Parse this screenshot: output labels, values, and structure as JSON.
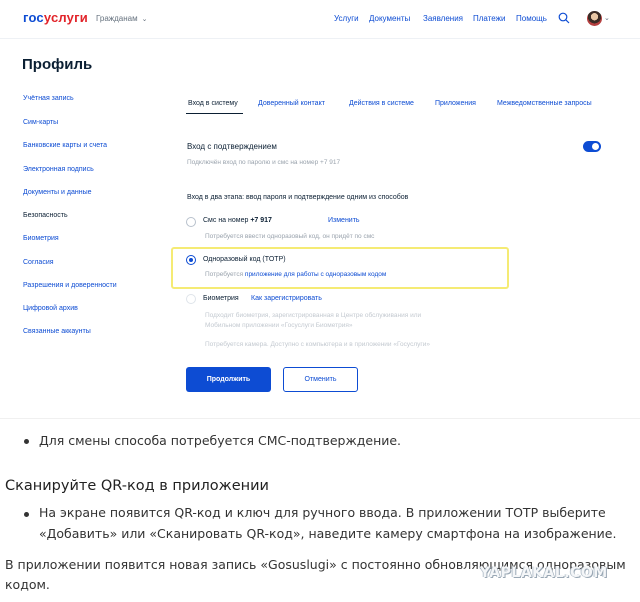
{
  "header": {
    "logo_part1": "гос",
    "logo_part2": "услуги",
    "audience": "Гражданам",
    "nav": [
      "Услуги",
      "Документы",
      "Заявления",
      "Платежи",
      "Помощь"
    ]
  },
  "page": {
    "title": "Профиль"
  },
  "sidebar": {
    "items": [
      "Учётная запись",
      "Сим-карты",
      "Банковские карты и счета",
      "Электронная подпись",
      "Документы и данные",
      "Безопасность",
      "Биометрия",
      "Согласия",
      "Разрешения и доверенности",
      "Цифровой архив",
      "Связанные аккаунты"
    ],
    "active_index": 5
  },
  "tabs": [
    "Вход в систему",
    "Доверенный контакт",
    "Действия в системе",
    "Приложения",
    "Межведомственные запросы"
  ],
  "security": {
    "confirm_title": "Вход с подтверждением",
    "confirm_desc": "Подключён вход по паролю и смс на номер +7 917",
    "confirm_enabled": true,
    "two_step_intro": "Вход в два этапа: ввод пароля и подтверждение одним из способов",
    "options": {
      "sms": {
        "label": "Смс на номер",
        "number": "+7 917",
        "change": "Изменить",
        "hint": "Потребуется ввести одноразовый код, он придёт по смс"
      },
      "totp": {
        "label": "Одноразовый код (TOTP)",
        "hint_prefix": "Потребуется",
        "hint_link": "приложение для работы с одноразовым кодом"
      },
      "bio": {
        "label": "Биометрия",
        "link": "Как зарегистрировать",
        "hint1": "Подходит биометрия, зарегистрированная в Центре обслуживания или",
        "hint2": "Мобильном приложении «Госуслуги Биометрия»",
        "hint3": "Потребуется камера. Доступно с компьютера и в приложении «Госуслуги»"
      }
    },
    "selected": "totp",
    "continue_button": "Продолжить",
    "cancel_button": "Отменить"
  },
  "article": {
    "bullet1": "Для смены способа потребуется СМС-подтверждение.",
    "heading": "Сканируйте QR-код в приложении",
    "bullet2_line1": "На экране появится QR-код и ключ для ручного ввода. В приложении TOTP выберите",
    "bullet2_line2": "«Добавить» или «Сканировать QR-код», наведите камеру смартфона на изображение.",
    "para_line1": "В приложении появится новая запись «Gosuslugi» с постоянно обновляющимся одноразовым",
    "para_line2": "кодом."
  },
  "watermark": "YAPLAKAL.COM",
  "colors": {
    "accent": "#0d4cd3",
    "brand_red": "#e2242a",
    "highlight": "#f5eb74"
  }
}
